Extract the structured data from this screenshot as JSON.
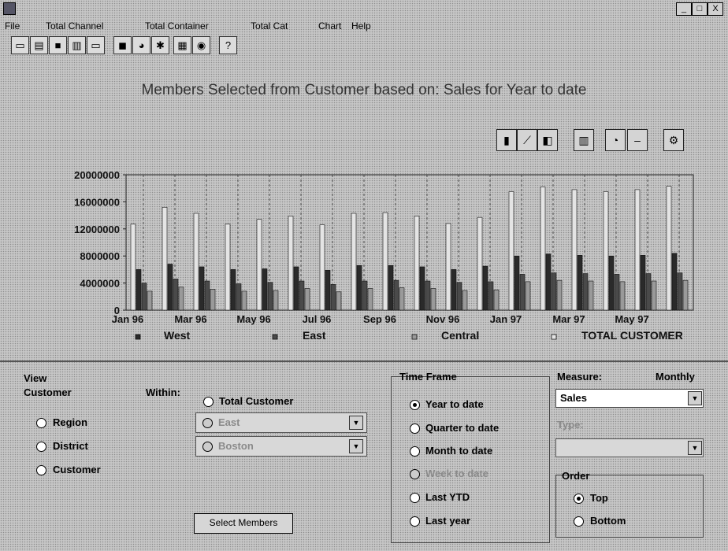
{
  "menu": [
    "File",
    "Total Channel",
    "Total Container",
    "Total Cat",
    "Chart",
    "Help"
  ],
  "window": {
    "min": "_",
    "max": "□",
    "close": "X"
  },
  "toolbar_icons": [
    "new-icon",
    "open-icon",
    "save-icon",
    "print-icon",
    "preview-icon",
    "cube-icon",
    "clock-icon",
    "chart-wizard-icon",
    "grid-icon",
    "refresh-icon",
    "help-icon"
  ],
  "chart_tools": [
    "bar-chart-icon",
    "line-chart-icon",
    "area-chart-icon",
    "stacked-chart-icon",
    "pie-chart-icon",
    "dash-icon",
    "settings-icon"
  ],
  "chart_data": {
    "type": "bar",
    "title": "Members Selected from Customer based on: Sales for Year to date",
    "ylim": [
      0,
      20000000
    ],
    "yticks": [
      "20000000",
      "16000000",
      "12000000",
      "8000000",
      "4000000",
      "0"
    ],
    "xticks": [
      "Jan 96",
      "Mar 96",
      "May 96",
      "Jul 96",
      "Sep 96",
      "Nov 96",
      "Jan 97",
      "Mar 97",
      "May 97"
    ],
    "categories": [
      "Jan 96",
      "Feb 96",
      "Mar 96",
      "Apr 96",
      "May 96",
      "Jun 96",
      "Jul 96",
      "Aug 96",
      "Sep 96",
      "Oct 96",
      "Nov 96",
      "Dec 96",
      "Jan 97",
      "Feb 97",
      "Mar 97",
      "Apr 97",
      "May 97",
      "Jun 97"
    ],
    "series": [
      {
        "name": "West",
        "color": "#2a2a2a",
        "values": [
          6000000,
          6800000,
          6400000,
          6000000,
          6100000,
          6400000,
          5900000,
          6600000,
          6600000,
          6400000,
          6000000,
          6500000,
          8000000,
          8300000,
          8100000,
          8000000,
          8100000,
          8400000
        ]
      },
      {
        "name": "East",
        "color": "#4a4a4a",
        "values": [
          4000000,
          4600000,
          4300000,
          3900000,
          4100000,
          4300000,
          3800000,
          4300000,
          4400000,
          4300000,
          4100000,
          4200000,
          5300000,
          5500000,
          5400000,
          5300000,
          5400000,
          5500000
        ]
      },
      {
        "name": "Central",
        "color": "#9a9a9a",
        "values": [
          2800000,
          3400000,
          3100000,
          2800000,
          2900000,
          3200000,
          2700000,
          3200000,
          3300000,
          3200000,
          2900000,
          3000000,
          4200000,
          4400000,
          4300000,
          4200000,
          4300000,
          4400000
        ]
      },
      {
        "name": "TOTAL CUSTOMER",
        "color": "#e4e4e4",
        "values": [
          12700000,
          15200000,
          14300000,
          12700000,
          13400000,
          13900000,
          12600000,
          14300000,
          14400000,
          13900000,
          12800000,
          13700000,
          17500000,
          18200000,
          17800000,
          17500000,
          17800000,
          18300000
        ]
      }
    ]
  },
  "legend": [
    "West",
    "East",
    "Central",
    "TOTAL CUSTOMER"
  ],
  "view": {
    "title": "View",
    "customer_label": "Customer",
    "within_label": "Within:",
    "options": [
      "Region",
      "District",
      "Customer"
    ],
    "total_customer": "Total Customer",
    "east_value": "East",
    "boston_value": "Boston",
    "select_members": "Select Members"
  },
  "timeframe": {
    "title": "Time Frame",
    "options": [
      "Year to date",
      "Quarter to date",
      "Month to date",
      "Week to date",
      "Last YTD",
      "Last year"
    ]
  },
  "measure": {
    "label": "Measure:",
    "period": "Monthly",
    "value": "Sales",
    "type_label": "Type:"
  },
  "order": {
    "title": "Order",
    "options": [
      "Top",
      "Bottom"
    ]
  }
}
